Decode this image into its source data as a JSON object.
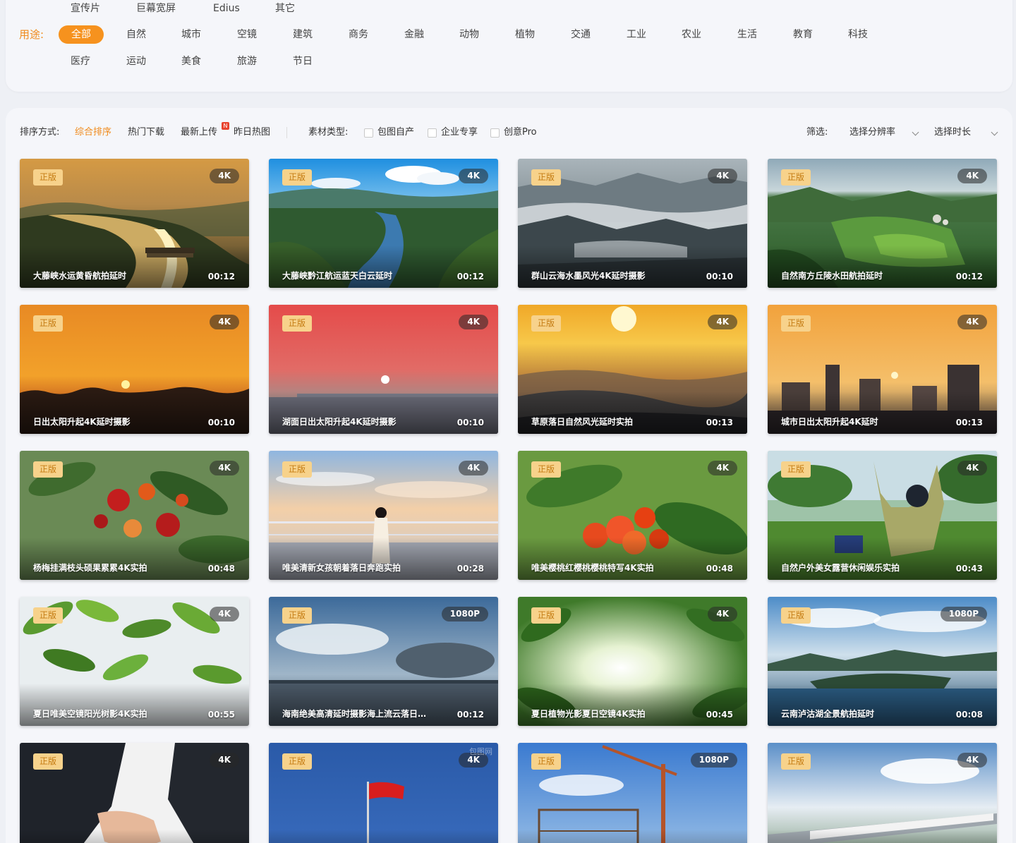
{
  "filters": {
    "row1": [
      "宣传片",
      "巨幕宽屏",
      "Edius",
      "其它"
    ],
    "usage_label": "用途:",
    "usage_active": "全部",
    "row2": [
      "自然",
      "城市",
      "空镜",
      "建筑",
      "商务",
      "金融",
      "动物",
      "植物",
      "交通",
      "工业",
      "农业",
      "生活",
      "教育",
      "科技"
    ],
    "row3": [
      "医疗",
      "运动",
      "美食",
      "旅游",
      "节日"
    ]
  },
  "toolbar": {
    "sort_label": "排序方式:",
    "sort_options": [
      "综合排序",
      "热门下载",
      "最新上传",
      "昨日热图"
    ],
    "sort_active": "综合排序",
    "new_badge": "N",
    "type_label": "素材类型:",
    "type_options": [
      "包图自产",
      "企业专享",
      "创意Pro"
    ],
    "filter_label": "筛选:",
    "resolution_select": "选择分辨率",
    "duration_select": "选择时长"
  },
  "cards": [
    {
      "badge": "正版",
      "res": "4K",
      "title": "大藤峡水运黄昏航拍延时",
      "dur": "00:12",
      "scene": "river-dusk"
    },
    {
      "badge": "正版",
      "res": "4K",
      "title": "大藤峡黔江航运蓝天白云延时",
      "dur": "00:12",
      "scene": "river-blue"
    },
    {
      "badge": "正版",
      "res": "4K",
      "title": "群山云海水墨风光4K延时摄影",
      "dur": "00:10",
      "scene": "mist-mountain"
    },
    {
      "badge": "正版",
      "res": "4K",
      "title": "自然南方丘陵水田航拍延时",
      "dur": "00:12",
      "scene": "green-fields"
    },
    {
      "badge": "正版",
      "res": "4K",
      "title": "日出太阳升起4K延时摄影",
      "dur": "00:10",
      "scene": "sunrise-orange"
    },
    {
      "badge": "正版",
      "res": "4K",
      "title": "湖面日出太阳升起4K延时摄影",
      "dur": "00:10",
      "scene": "sunrise-red"
    },
    {
      "badge": "正版",
      "res": "4K",
      "title": "草原落日自然风光延时实拍",
      "dur": "00:13",
      "scene": "sunset-hills"
    },
    {
      "badge": "正版",
      "res": "4K",
      "title": "城市日出太阳升起4K延时",
      "dur": "00:13",
      "scene": "city-sunrise"
    },
    {
      "badge": "正版",
      "res": "4K",
      "title": "杨梅挂满枝头硕果累累4K实拍",
      "dur": "00:48",
      "scene": "berries"
    },
    {
      "badge": "正版",
      "res": "4K",
      "title": "唯美清新女孩朝着落日奔跑实拍",
      "dur": "00:28",
      "scene": "girl-sky"
    },
    {
      "badge": "正版",
      "res": "4K",
      "title": "唯美樱桃红樱桃樱桃特写4K实拍",
      "dur": "00:48",
      "scene": "cherries"
    },
    {
      "badge": "正版",
      "res": "4K",
      "title": "自然户外美女露营休闲娱乐实拍",
      "dur": "00:43",
      "scene": "camping"
    },
    {
      "badge": "正版",
      "res": "4K",
      "title": "夏日唯美空镜阳光树影4K实拍",
      "dur": "00:55",
      "scene": "leaves"
    },
    {
      "badge": "正版",
      "res": "1080P",
      "title": "海南绝美高清延时摄影海上流云落日…",
      "dur": "00:12",
      "scene": "sea-clouds"
    },
    {
      "badge": "正版",
      "res": "4K",
      "title": "夏日植物光影夏日空镜4K实拍",
      "dur": "00:45",
      "scene": "sun-leaves"
    },
    {
      "badge": "正版",
      "res": "1080P",
      "title": "云南泸沽湖全景航拍延时",
      "dur": "00:08",
      "scene": "lake"
    },
    {
      "badge": "正版",
      "res": "4K",
      "title": "",
      "dur": "",
      "scene": "handshake"
    },
    {
      "badge": "正版",
      "res": "4K",
      "title": "",
      "dur": "",
      "scene": "flag",
      "watermark": "包图网"
    },
    {
      "badge": "正版",
      "res": "1080P",
      "title": "",
      "dur": "",
      "scene": "crane"
    },
    {
      "badge": "正版",
      "res": "4K",
      "title": "",
      "dur": "",
      "scene": "train"
    }
  ]
}
